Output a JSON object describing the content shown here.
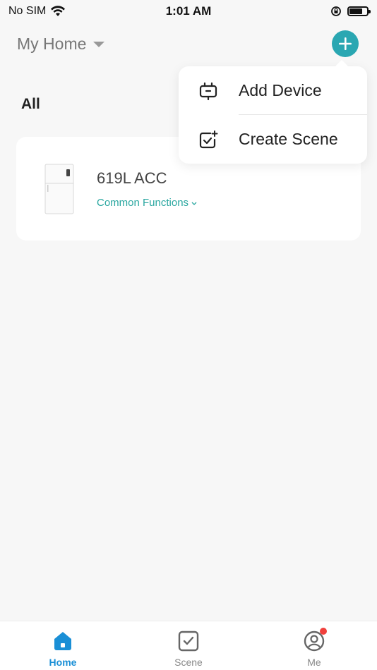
{
  "status_bar": {
    "carrier": "No SIM",
    "time": "1:01 AM",
    "battery_level": 0.75
  },
  "header": {
    "home_name": "My Home",
    "add_icon": "plus-icon"
  },
  "section": {
    "label": "All"
  },
  "device": {
    "name": "619L ACC",
    "functions_label": "Common Functions"
  },
  "popup_menu": {
    "items": [
      {
        "label": "Add Device",
        "icon": "device-icon"
      },
      {
        "label": "Create Scene",
        "icon": "scene-add-icon"
      }
    ]
  },
  "tabs": [
    {
      "label": "Home",
      "icon": "home-icon",
      "active": true
    },
    {
      "label": "Scene",
      "icon": "scene-icon",
      "active": false
    },
    {
      "label": "Me",
      "icon": "profile-icon",
      "active": false
    }
  ],
  "colors": {
    "accent": "#2aa7b2",
    "tab_active": "#1a8fd6",
    "functions_text": "#2aa7a0",
    "badge": "#f0403c"
  }
}
